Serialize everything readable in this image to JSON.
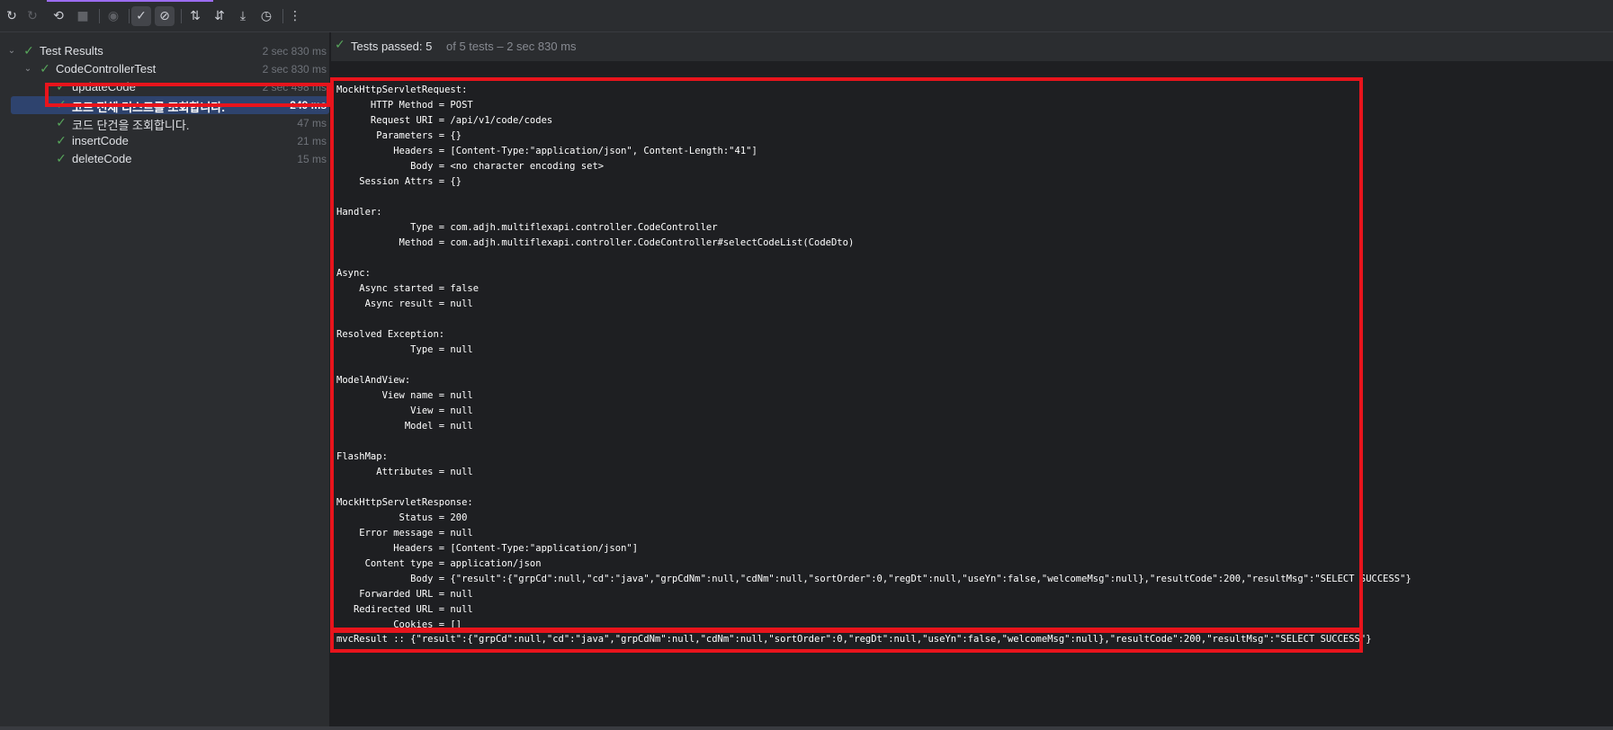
{
  "toolbar": {
    "icons": [
      "rerun-icon",
      "rerun-failed-icon",
      "toggle-auto-test-icon",
      "stop-icon",
      "eye-icon",
      "show-passed-icon",
      "show-ignored-icon",
      "sort-alphabetically-icon",
      "sort-by-duration-icon",
      "import-tests-icon",
      "test-history-icon",
      "more-options-icon"
    ]
  },
  "tree": {
    "items": [
      {
        "label": "Test Results",
        "time": "2 sec 830 ms"
      },
      {
        "label": "CodeControllerTest",
        "time": "2 sec 830 ms"
      },
      {
        "label": "updateCode",
        "time": "2 sec 498 ms"
      },
      {
        "label": "코드 전체 리스트를 조회합니다.",
        "time": "249 ms"
      },
      {
        "label": "코드 단건을 조회합니다.",
        "time": "47 ms"
      },
      {
        "label": "insertCode",
        "time": "21 ms"
      },
      {
        "label": "deleteCode",
        "time": "15 ms"
      }
    ]
  },
  "status": {
    "main": "Tests passed: 5",
    "rest": "of 5 tests – 2 sec 830 ms"
  },
  "console": {
    "lines": [
      "MockHttpServletRequest:",
      "      HTTP Method = POST",
      "      Request URI = /api/v1/code/codes",
      "       Parameters = {}",
      "          Headers = [Content-Type:\"application/json\", Content-Length:\"41\"]",
      "             Body = <no character encoding set>",
      "    Session Attrs = {}",
      "",
      "Handler:",
      "             Type = com.adjh.multiflexapi.controller.CodeController",
      "           Method = com.adjh.multiflexapi.controller.CodeController#selectCodeList(CodeDto)",
      "",
      "Async:",
      "    Async started = false",
      "     Async result = null",
      "",
      "Resolved Exception:",
      "             Type = null",
      "",
      "ModelAndView:",
      "        View name = null",
      "             View = null",
      "            Model = null",
      "",
      "FlashMap:",
      "       Attributes = null",
      "",
      "MockHttpServletResponse:",
      "           Status = 200",
      "    Error message = null",
      "          Headers = [Content-Type:\"application/json\"]",
      "     Content type = application/json",
      "             Body = {\"result\":{\"grpCd\":null,\"cd\":\"java\",\"grpCdNm\":null,\"cdNm\":null,\"sortOrder\":0,\"regDt\":null,\"useYn\":false,\"welcomeMsg\":null},\"resultCode\":200,\"resultMsg\":\"SELECT SUCCESS\"}",
      "    Forwarded URL = null",
      "   Redirected URL = null",
      "          Cookies = []",
      "mvcResult :: {\"result\":{\"grpCd\":null,\"cd\":\"java\",\"grpCdNm\":null,\"cdNm\":null,\"sortOrder\":0,\"regDt\":null,\"useYn\":false,\"welcomeMsg\":null},\"resultCode\":200,\"resultMsg\":\"SELECT SUCCESS\"}"
    ]
  },
  "colors": {
    "highlight": "#e8141c",
    "pass": "#57a65b",
    "selection": "#2e436e",
    "accent": "#9b6cf0"
  }
}
